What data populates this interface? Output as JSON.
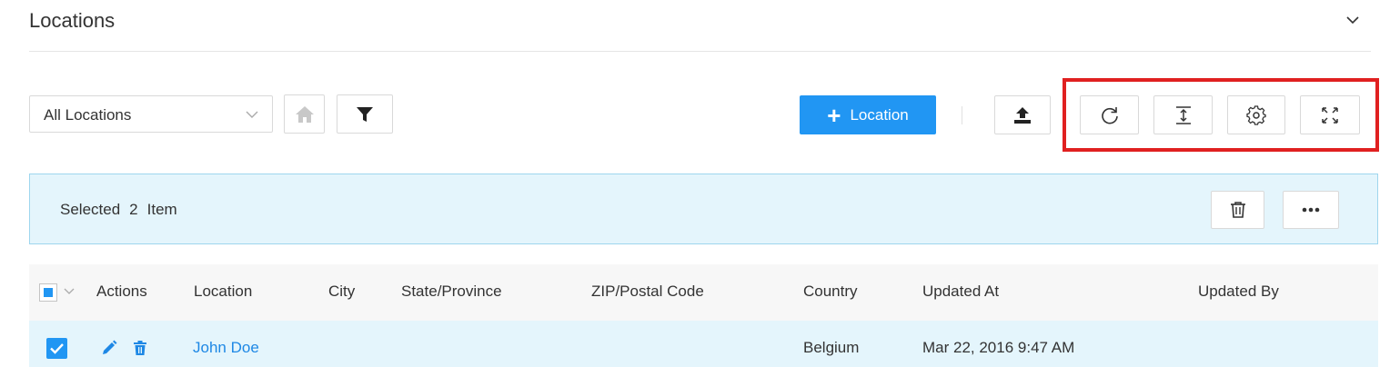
{
  "page": {
    "title": "Locations"
  },
  "toolbar": {
    "location_filter": "All Locations",
    "add_label": "Location"
  },
  "selection": {
    "prefix": "Selected",
    "count": "2",
    "suffix": "Item"
  },
  "table": {
    "columns": [
      "Actions",
      "Location",
      "City",
      "State/Province",
      "ZIP/Postal Code",
      "Country",
      "Updated At",
      "Updated By"
    ],
    "rows": [
      {
        "location": "John Doe",
        "city": "",
        "state": "",
        "zip": "",
        "country": "Belgium",
        "updated_at": "Mar 22, 2016 9:47 AM",
        "updated_by": ""
      }
    ]
  },
  "colors": {
    "accent": "#2196f3",
    "selection_bg": "#e4f5fc",
    "highlight": "#e02020"
  },
  "icons": [
    "chevron-down-icon",
    "home-icon",
    "filter-icon",
    "plus-icon",
    "upload-icon",
    "refresh-icon",
    "row-height-icon",
    "gear-icon",
    "fullscreen-icon",
    "trash-icon",
    "more-icon",
    "pencil-icon",
    "checkbox-icon"
  ]
}
